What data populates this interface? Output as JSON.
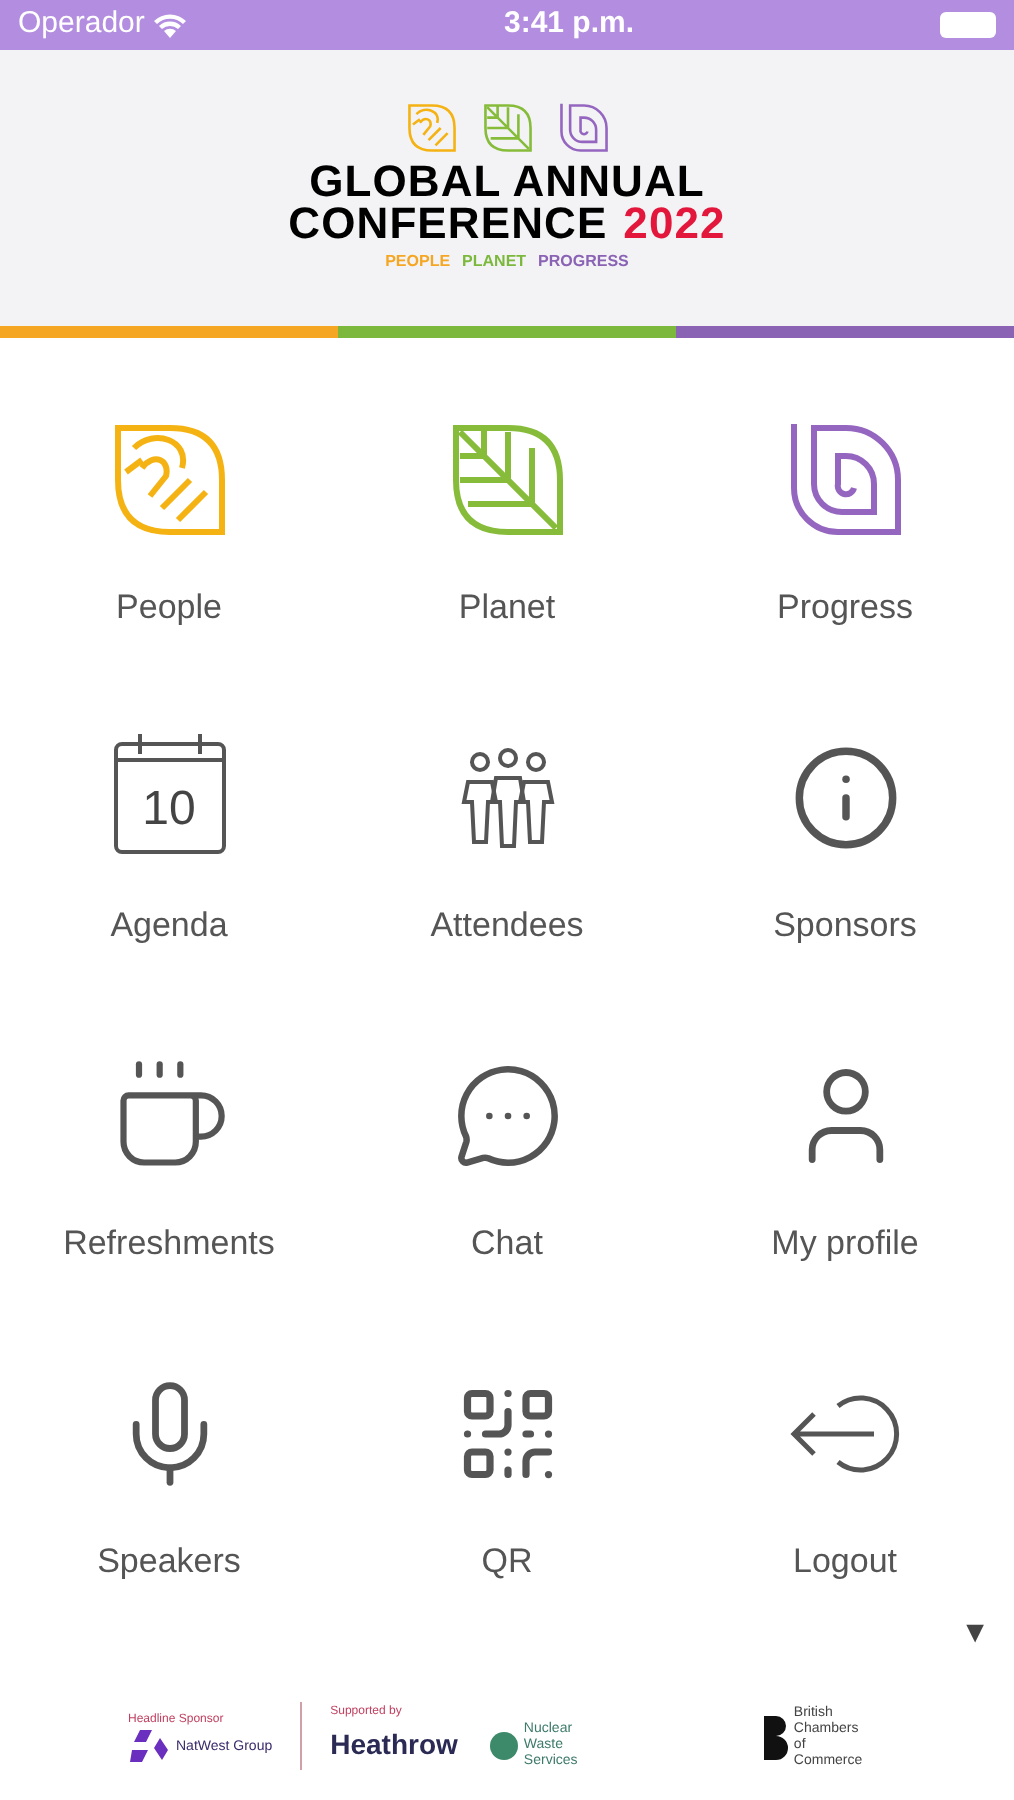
{
  "status_bar": {
    "carrier": "Operador",
    "time": "3:41 p.m."
  },
  "header": {
    "title_line1": "GLOBAL ANNUAL",
    "title_line2": "CONFERENCE",
    "year": "2022",
    "tagline": [
      {
        "text": "PEOPLE",
        "color": "#f5a623"
      },
      {
        "text": "PLANET",
        "color": "#7cb83b"
      },
      {
        "text": "PROGRESS",
        "color": "#8a63b5"
      }
    ]
  },
  "menu": [
    {
      "label": "People",
      "kind": "people"
    },
    {
      "label": "Planet",
      "kind": "planet"
    },
    {
      "label": "Progress",
      "kind": "progress"
    },
    {
      "label": "Agenda",
      "kind": "calendar",
      "icon_text": "10"
    },
    {
      "label": "Attendees",
      "kind": "attendees"
    },
    {
      "label": "Sponsors",
      "kind": "info"
    },
    {
      "label": "Refreshments",
      "kind": "cup"
    },
    {
      "label": "Chat",
      "kind": "chat"
    },
    {
      "label": "My profile",
      "kind": "user"
    },
    {
      "label": "Speakers",
      "kind": "mic"
    },
    {
      "label": "QR",
      "kind": "qr"
    },
    {
      "label": "Logout",
      "kind": "logout"
    }
  ],
  "scroll_indicator": "▼",
  "sponsors": {
    "headline_caption": "Headline Sponsor",
    "headline": "NatWest Group",
    "support_caption": "Supported by",
    "supporters": [
      "Heathrow",
      "Nuclear Waste Services"
    ],
    "partner": "British Chambers of Commerce"
  }
}
